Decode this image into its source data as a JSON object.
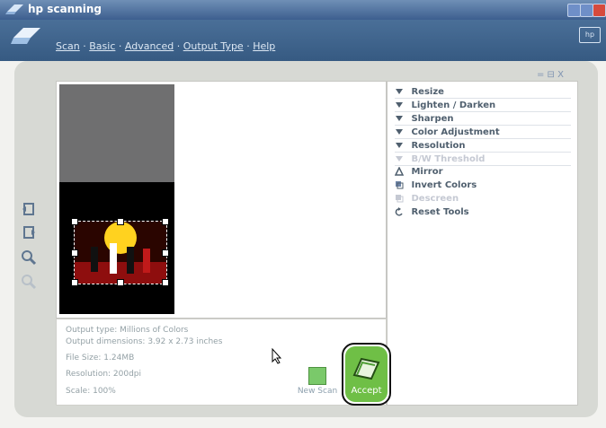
{
  "titlebar": {
    "title": "hp scanning"
  },
  "header": {
    "menu": [
      "Scan",
      "Basic",
      "Advanced",
      "Output Type",
      "Help"
    ],
    "badge": "hp"
  },
  "panel": {
    "controls": "= ⊟ X",
    "items": [
      {
        "label": "Resize",
        "icon": "triangle-down-icon"
      },
      {
        "label": "Lighten / Darken",
        "icon": "triangle-down-icon"
      },
      {
        "label": "Sharpen",
        "icon": "triangle-down-icon"
      },
      {
        "label": "Color Adjustment",
        "icon": "triangle-down-icon"
      },
      {
        "label": "Resolution",
        "icon": "triangle-down-icon"
      },
      {
        "label": "B/W Threshold",
        "icon": "triangle-down-icon"
      },
      {
        "label": "Mirror",
        "icon": "mirror-icon"
      },
      {
        "label": "Invert Colors",
        "icon": "invert-icon"
      },
      {
        "label": "Descreen",
        "icon": "descreen-icon"
      },
      {
        "label": "Reset Tools",
        "icon": "reset-icon"
      }
    ]
  },
  "info": {
    "output_type": "Output type: Millions of Colors",
    "output_dimensions": "Output dimensions: 3.92 x 2.73 inches",
    "file_size": "File Size: 1.24MB",
    "resolution": "Resolution: 200dpi",
    "scale": "Scale: 100%"
  },
  "buttons": {
    "new_scan": "New Scan",
    "accept": "Accept"
  },
  "colors": {
    "title_bar": "#3d5f8f",
    "header": "#4a6f98",
    "accept_green": "#6fbf46",
    "tool_text": "#4f5f6e"
  }
}
